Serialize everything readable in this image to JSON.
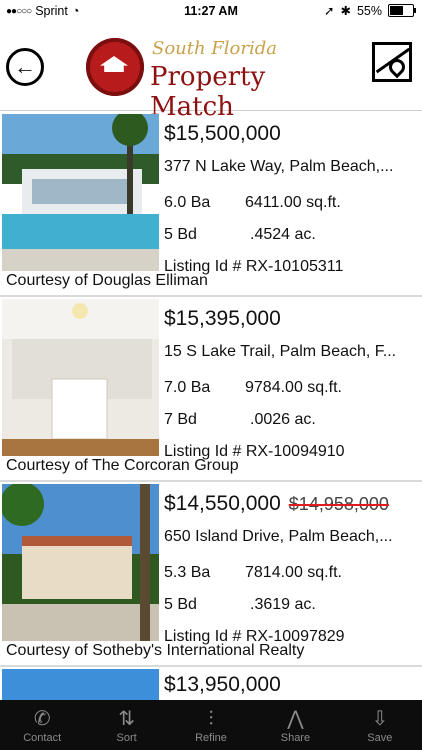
{
  "status_bar": {
    "carrier": "Sprint",
    "time": "11:27 AM",
    "battery": "55%"
  },
  "header": {
    "logo_top": "South Florida",
    "logo_main": "Property Match"
  },
  "listings": [
    {
      "price": "$15,500,000",
      "old_price": "",
      "address": "377 N Lake Way, Palm Beach,...",
      "baths": "6.0 Ba",
      "sqft": "6411.00 sq.ft.",
      "beds": "5 Bd",
      "acres": ".4524 ac.",
      "listing_id": "Listing Id # RX-10105311",
      "courtesy": "Courtesy of Douglas Elliman"
    },
    {
      "price": "$15,395,000",
      "old_price": "",
      "address": "15 S Lake Trail, Palm Beach, F...",
      "baths": "7.0 Ba",
      "sqft": "9784.00 sq.ft.",
      "beds": "7 Bd",
      "acres": ".0026 ac.",
      "listing_id": "Listing Id # RX-10094910",
      "courtesy": "Courtesy of The Corcoran Group"
    },
    {
      "price": "$14,550,000",
      "old_price": "$14,958,000",
      "address": "650 Island Drive, Palm Beach,...",
      "baths": "5.3 Ba",
      "sqft": "7814.00 sq.ft.",
      "beds": "5 Bd",
      "acres": ".3619 ac.",
      "listing_id": "Listing Id # RX-10097829",
      "courtesy": "Courtesy of Sotheby's International Realty"
    },
    {
      "price": "$13,950,000"
    }
  ],
  "tabs": [
    {
      "label": "Contact",
      "icon": "phone-icon"
    },
    {
      "label": "Sort",
      "icon": "sort-icon"
    },
    {
      "label": "Refine",
      "icon": "sliders-icon"
    },
    {
      "label": "Share",
      "icon": "share-icon"
    },
    {
      "label": "Save",
      "icon": "download-icon"
    }
  ]
}
